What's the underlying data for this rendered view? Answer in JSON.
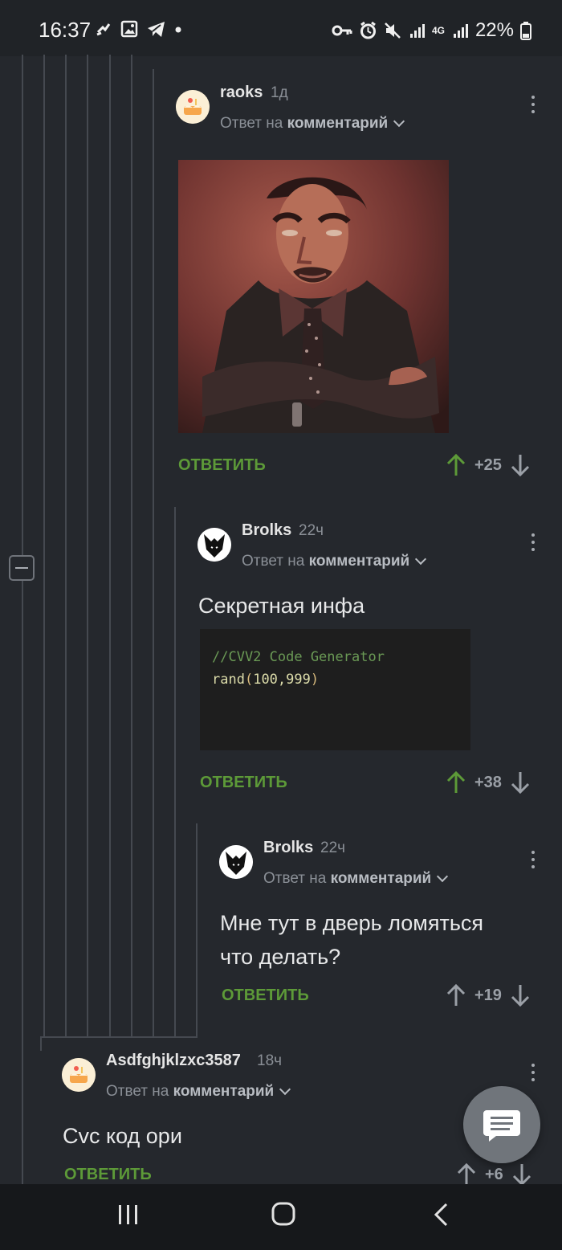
{
  "status_bar": {
    "time": "16:37",
    "battery": "22%",
    "network": "4G",
    "icons": [
      "notification-icon",
      "image-icon",
      "telegram-icon",
      "dot-icon",
      "vpn-key-icon",
      "alarm-icon",
      "mute-icon",
      "signal-icon",
      "battery-icon"
    ]
  },
  "comments": [
    {
      "author": "raoks",
      "time": "1д",
      "reply_prefix": "Ответ на",
      "reply_target": "комментарий",
      "reply_label": "ОТВЕТИТЬ",
      "score": "+25",
      "has_image": true
    },
    {
      "author": "Brolks",
      "time": "22ч",
      "reply_prefix": "Ответ на",
      "reply_target": "комментарий",
      "text": "Секретная инфа",
      "code_comment": "//CVV2 Code Generator",
      "code_func": "rand",
      "code_args_open": "(",
      "code_args": "100,999",
      "code_args_close": ")",
      "reply_label": "ОТВЕТИТЬ",
      "score": "+38"
    },
    {
      "author": "Brolks",
      "time": "22ч",
      "reply_prefix": "Ответ на",
      "reply_target": "комментарий",
      "text_line_1": "Мне тут в дверь ломяться",
      "text_line_2": "что делать?",
      "reply_label": "ОТВЕТИТЬ",
      "score": "+19"
    },
    {
      "author": "Asdfghjklzxc3587",
      "time": "18ч",
      "reply_prefix": "Ответ на",
      "reply_target": "комментарий",
      "text": "Cvc код ори",
      "reply_label": "ОТВЕТИТЬ",
      "score": "+6"
    }
  ],
  "colors": {
    "background": "#25282d",
    "reply_green": "#5d9a38",
    "upvote_green": "#5d9a38",
    "muted_text": "#8a8f96"
  }
}
